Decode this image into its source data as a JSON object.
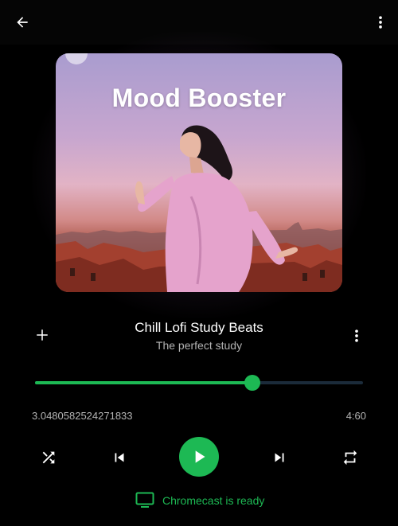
{
  "header": {
    "back_icon": "arrow-left-icon",
    "menu_icon": "more-vert-icon"
  },
  "album": {
    "art_title": "Mood Booster"
  },
  "track": {
    "title": "Chill Lofi Study Beats",
    "subtitle": "The perfect study",
    "add_icon": "plus-icon",
    "menu_icon": "more-vert-icon"
  },
  "progress": {
    "fraction": 0.663,
    "elapsed": "3.0480582524271833",
    "total": "4:60"
  },
  "controls": {
    "shuffle_icon": "shuffle-icon",
    "prev_icon": "skip-previous-icon",
    "play_icon": "play-icon",
    "next_icon": "skip-next-icon",
    "repeat_icon": "repeat-icon"
  },
  "cast": {
    "label": "Chromecast is ready",
    "icon": "tv-icon"
  },
  "colors": {
    "accent": "#1db954",
    "background": "#000000",
    "secondary_text": "#b3b3b3",
    "track_bg": "#1b2b3a"
  }
}
